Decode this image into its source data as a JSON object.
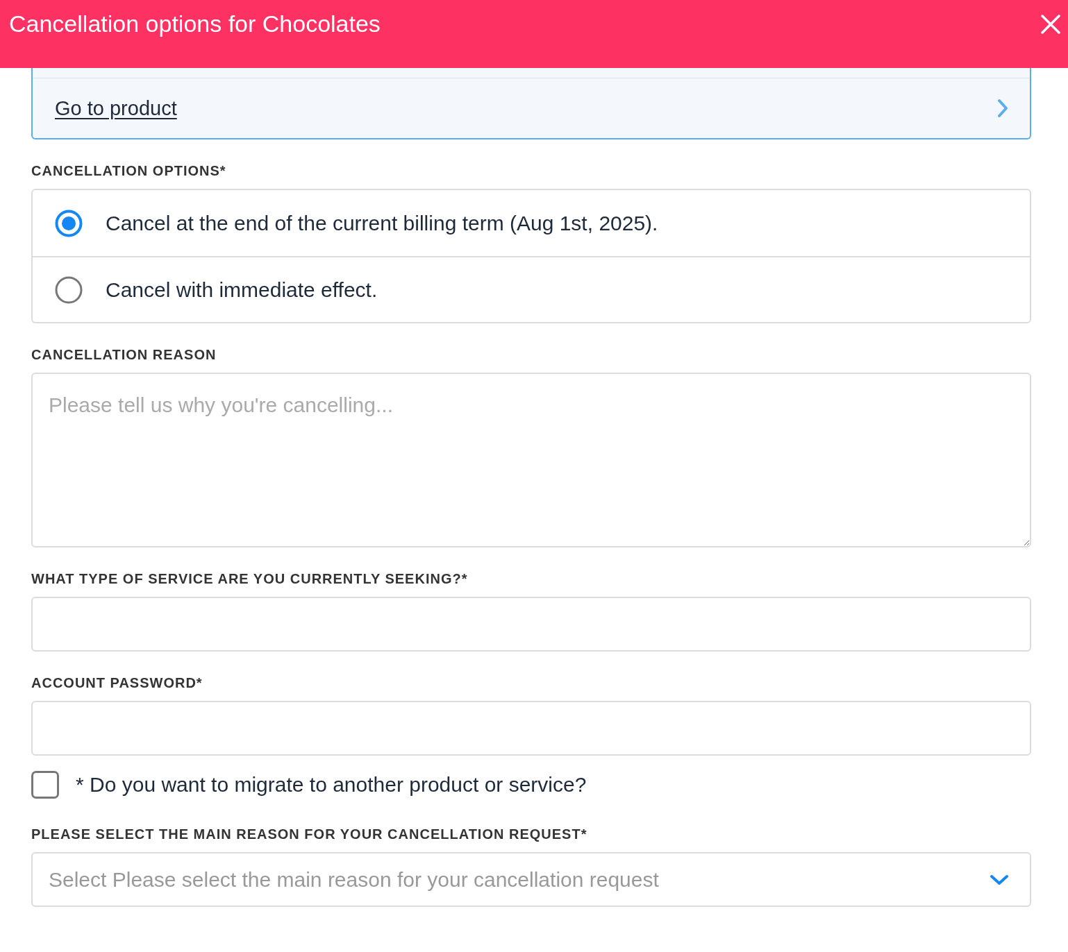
{
  "header": {
    "title": "Cancellation options for Chocolates"
  },
  "product_card": {
    "link": "Go to product"
  },
  "fields": [
    {
      "kind": "radio_group",
      "label": "CANCELLATION OPTIONS*",
      "options": [
        {
          "label": "Cancel at the end of the current billing term (Aug 1st, 2025).",
          "selected": true
        },
        {
          "label": "Cancel with immediate effect.",
          "selected": false
        }
      ]
    },
    {
      "kind": "textarea",
      "label": "CANCELLATION REASON",
      "placeholder": "Please tell us why you're cancelling..."
    },
    {
      "kind": "text",
      "label": "WHAT TYPE OF SERVICE ARE YOU CURRENTLY SEEKING?*"
    },
    {
      "kind": "password",
      "label": "ACCOUNT PASSWORD*"
    },
    {
      "kind": "checkbox",
      "label": "* Do you want to migrate to another product or service?",
      "checked": false
    },
    {
      "kind": "select",
      "label": "PLEASE SELECT THE MAIN REASON FOR YOUR CANCELLATION REQUEST*",
      "placeholder": "Select Please select the main reason for your cancellation request"
    }
  ]
}
